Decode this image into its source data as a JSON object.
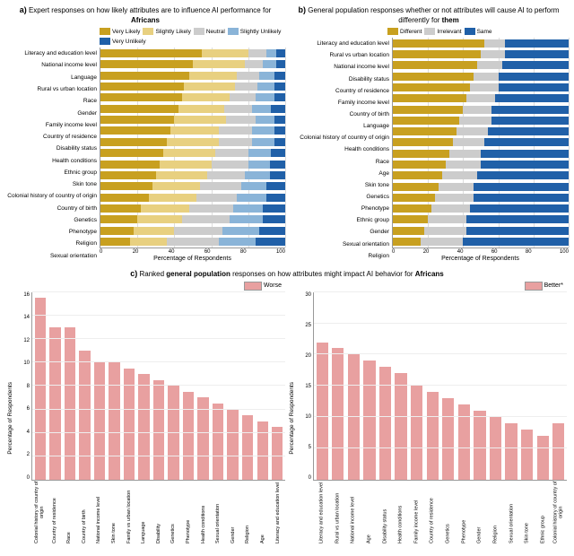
{
  "panelA": {
    "label": "a)",
    "title": "Expert responses on how likely attributes are to influence AI performance for ",
    "bold": "Africans",
    "legend": [
      {
        "label": "Very Likely",
        "color": "#c8a020"
      },
      {
        "label": "Slightly Likely",
        "color": "#e8d080"
      },
      {
        "label": "Neutral",
        "color": "#cccccc"
      },
      {
        "label": "Slightly Unlikely",
        "color": "#8ab4d8"
      },
      {
        "label": "Very Unlikely",
        "color": "#2060a8"
      }
    ],
    "yLabels": [
      "Literacy and education level",
      "National income level",
      "Language",
      "Rural vs urban location",
      "Race",
      "Gender",
      "Family income level",
      "Country of residence",
      "Disability status",
      "Health conditions",
      "Ethnic group",
      "Skin tone",
      "Colonial history of country of origin",
      "Country of birth",
      "Genetics",
      "Phenotype",
      "Religion",
      "Sexual orientation"
    ],
    "bars": [
      [
        55,
        25,
        10,
        5,
        5
      ],
      [
        50,
        28,
        10,
        7,
        5
      ],
      [
        48,
        26,
        12,
        8,
        6
      ],
      [
        45,
        28,
        12,
        9,
        6
      ],
      [
        44,
        26,
        14,
        10,
        6
      ],
      [
        42,
        25,
        15,
        10,
        8
      ],
      [
        40,
        28,
        16,
        10,
        6
      ],
      [
        38,
        26,
        18,
        12,
        6
      ],
      [
        36,
        28,
        18,
        12,
        6
      ],
      [
        34,
        28,
        18,
        12,
        8
      ],
      [
        32,
        28,
        20,
        12,
        8
      ],
      [
        30,
        28,
        20,
        14,
        8
      ],
      [
        28,
        26,
        22,
        14,
        10
      ],
      [
        26,
        26,
        22,
        16,
        10
      ],
      [
        22,
        26,
        24,
        16,
        12
      ],
      [
        20,
        24,
        26,
        18,
        12
      ],
      [
        18,
        22,
        26,
        20,
        14
      ],
      [
        16,
        20,
        28,
        20,
        16
      ]
    ],
    "xLabels": [
      "0",
      "20",
      "40",
      "60",
      "80",
      "100"
    ],
    "xTitle": "Percentage of Respondents"
  },
  "panelB": {
    "label": "b)",
    "title": "General population responses whether or not attributes will cause AI to perform differently for ",
    "bold": "them",
    "legend": [
      {
        "label": "Different",
        "color": "#c8a020"
      },
      {
        "label": "Irrelevant",
        "color": "#cccccc"
      },
      {
        "label": "Same",
        "color": "#2060a8"
      }
    ],
    "yLabels": [
      "Literacy and education level",
      "Rural vs urban location",
      "National income level",
      "Disability status",
      "Country of residence",
      "Family income level",
      "Country of birth",
      "Language",
      "Colonial history of country of origin",
      "Health conditions",
      "Race",
      "Age",
      "Skin tone",
      "Genetics",
      "Phenotype",
      "Ethnic group",
      "Gender",
      "Sexual orientation",
      "Religion"
    ],
    "bars": [
      [
        52,
        12,
        36
      ],
      [
        50,
        14,
        36
      ],
      [
        48,
        14,
        38
      ],
      [
        46,
        14,
        40
      ],
      [
        44,
        16,
        40
      ],
      [
        42,
        16,
        42
      ],
      [
        40,
        16,
        44
      ],
      [
        38,
        18,
        44
      ],
      [
        36,
        18,
        46
      ],
      [
        34,
        18,
        48
      ],
      [
        32,
        18,
        50
      ],
      [
        30,
        20,
        50
      ],
      [
        28,
        20,
        52
      ],
      [
        26,
        20,
        54
      ],
      [
        24,
        22,
        54
      ],
      [
        22,
        22,
        56
      ],
      [
        20,
        22,
        58
      ],
      [
        18,
        24,
        58
      ],
      [
        16,
        24,
        60
      ]
    ],
    "xLabels": [
      "0",
      "20",
      "40",
      "60",
      "80",
      "100"
    ],
    "xTitle": "Percentage of Respondents"
  },
  "panelC": {
    "label": "c)",
    "title": "Ranked ",
    "bold1": "general population",
    "title2": " responses on how attributes might impact AI behavior for ",
    "bold2": "Africans",
    "subPanel1": {
      "legendLabel": "Worse",
      "legendColor": "#e8a0a0",
      "yTitle": "Percentage of Respondents",
      "yMax": 16,
      "yTicks": [
        0,
        2,
        4,
        6,
        8,
        10,
        12,
        14,
        16
      ],
      "bars": [
        {
          "label": "Colonial history of country of origin",
          "value": 15.5
        },
        {
          "label": "Country of residence",
          "value": 13
        },
        {
          "label": "Race",
          "value": 13
        },
        {
          "label": "Country of birth",
          "value": 11
        },
        {
          "label": "National income level",
          "value": 10
        },
        {
          "label": "Skin tone",
          "value": 10
        },
        {
          "label": "Family vs urban location",
          "value": 9.5
        },
        {
          "label": "Language",
          "value": 9
        },
        {
          "label": "Disability",
          "value": 8.5
        },
        {
          "label": "Genetics",
          "value": 8
        },
        {
          "label": "Phenotype",
          "value": 7.5
        },
        {
          "label": "Health conditions",
          "value": 7
        },
        {
          "label": "Sexual orientation",
          "value": 6.5
        },
        {
          "label": "Gender",
          "value": 6
        },
        {
          "label": "Religion",
          "value": 5.5
        },
        {
          "label": "Age",
          "value": 5
        },
        {
          "label": "Literacy and education level",
          "value": 4.5
        }
      ]
    },
    "subPanel2": {
      "legendLabel": "Better*",
      "legendColor": "#e8a0a0",
      "yTitle": "Percentage of Respondents",
      "yMax": 30,
      "yTicks": [
        0,
        5,
        10,
        15,
        20,
        25,
        30
      ],
      "bars": [
        {
          "label": "Literacy and education level",
          "value": 22
        },
        {
          "label": "Rural vs urban location",
          "value": 21
        },
        {
          "label": "National income level",
          "value": 20
        },
        {
          "label": "Age",
          "value": 19
        },
        {
          "label": "Disability status",
          "value": 18
        },
        {
          "label": "Health conditions",
          "value": 17
        },
        {
          "label": "Family income level",
          "value": 15
        },
        {
          "label": "Country of residence",
          "value": 14
        },
        {
          "label": "Genetics",
          "value": 13
        },
        {
          "label": "Phenotype",
          "value": 12
        },
        {
          "label": "Gender",
          "value": 11
        },
        {
          "label": "Religion",
          "value": 10
        },
        {
          "label": "Sexual orientation",
          "value": 9
        },
        {
          "label": "Skin tone",
          "value": 8
        },
        {
          "label": "Ethnic group",
          "value": 7
        },
        {
          "label": "Colonial history of country of origin",
          "value": 9
        }
      ]
    }
  },
  "colors": {
    "veryLikely": "#c8a020",
    "slightlyLikely": "#e8d080",
    "neutral": "#cccccc",
    "slightlyUnlikely": "#8ab4d8",
    "veryUnlikely": "#2060a8",
    "different": "#c8a020",
    "irrelevant": "#cccccc",
    "same": "#2060a8",
    "worse": "#e8a0a0",
    "better": "#e8a0a0"
  }
}
